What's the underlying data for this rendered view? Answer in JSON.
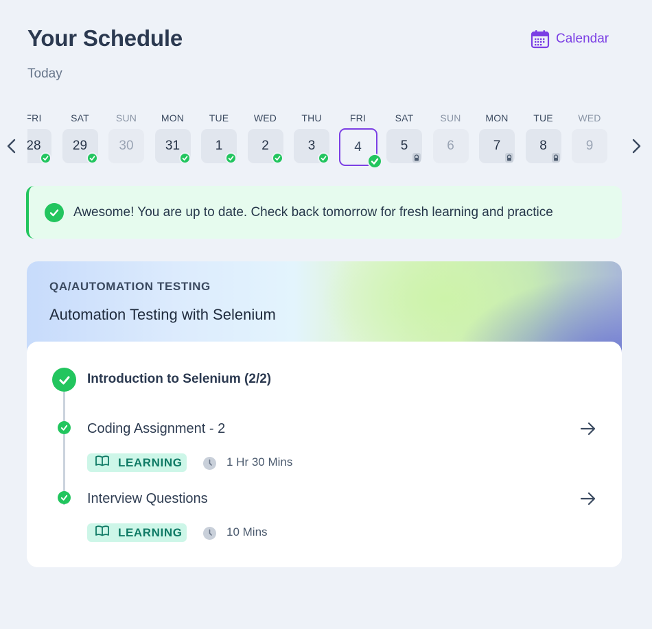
{
  "header": {
    "title": "Your Schedule",
    "subtitle": "Today",
    "calendar_label": "Calendar"
  },
  "colors": {
    "accent": "#7b3fe4",
    "success": "#22c55e",
    "tag_bg": "#cdf6e8",
    "tag_text": "#0f7a65"
  },
  "dates": [
    {
      "dow": "FRI",
      "num": "28",
      "status": "done"
    },
    {
      "dow": "SAT",
      "num": "29",
      "status": "done"
    },
    {
      "dow": "SUN",
      "num": "30",
      "status": "off"
    },
    {
      "dow": "MON",
      "num": "31",
      "status": "done"
    },
    {
      "dow": "TUE",
      "num": "1",
      "status": "done"
    },
    {
      "dow": "WED",
      "num": "2",
      "status": "done"
    },
    {
      "dow": "THU",
      "num": "3",
      "status": "done"
    },
    {
      "dow": "FRI",
      "num": "4",
      "status": "done",
      "selected": true
    },
    {
      "dow": "SAT",
      "num": "5",
      "status": "locked"
    },
    {
      "dow": "SUN",
      "num": "6",
      "status": "off"
    },
    {
      "dow": "MON",
      "num": "7",
      "status": "locked"
    },
    {
      "dow": "TUE",
      "num": "8",
      "status": "locked"
    },
    {
      "dow": "WED",
      "num": "9",
      "status": "off"
    }
  ],
  "banner": {
    "message": "Awesome! You are up to date. Check back tomorrow for fresh learning and practice"
  },
  "course": {
    "category": "QA/AUTOMATION TESTING",
    "title": "Automation Testing with Selenium",
    "module_title": "Introduction to Selenium (2/2)",
    "items": [
      {
        "title": "Coding Assignment - 2",
        "tag": "LEARNING",
        "duration": "1 Hr 30 Mins"
      },
      {
        "title": "Interview Questions",
        "tag": "LEARNING",
        "duration": "10 Mins"
      }
    ]
  }
}
